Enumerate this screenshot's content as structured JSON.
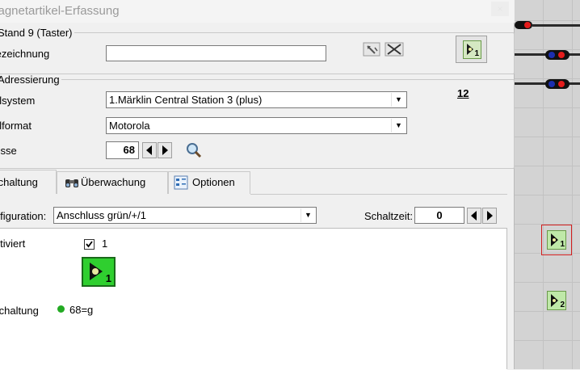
{
  "window": {
    "title": "Magnetartikel-Erfassung",
    "close": "×"
  },
  "group_name": {
    "legend": "Stand 9 (Taster)",
    "label": "Bezeichnung",
    "value": ""
  },
  "group_addr": {
    "legend": "Adressierung",
    "system_label": "Digitalsystem",
    "system_value": "1.Märklin Central Station 3 (plus)",
    "format_label": "Digitalformat",
    "format_value": "Motorola",
    "address_label": "Adresse",
    "address_value": "68",
    "numbutton": "12"
  },
  "tabs": [
    {
      "label": "Schaltung"
    },
    {
      "label": "Überwachung"
    },
    {
      "label": "Optionen"
    }
  ],
  "config": {
    "label": "Konfiguration:",
    "value": "Anschluss grün/+/1",
    "time_label": "Schaltzeit:",
    "time_value": "0"
  },
  "panel": {
    "activated_label": "Aktiviert",
    "checkbox_text": "1",
    "schaltung_label": "Schaltung",
    "schaltung_value": "68=g",
    "status_color": "#22aa22"
  },
  "track": {
    "icon1": "1",
    "icon2": "2"
  }
}
